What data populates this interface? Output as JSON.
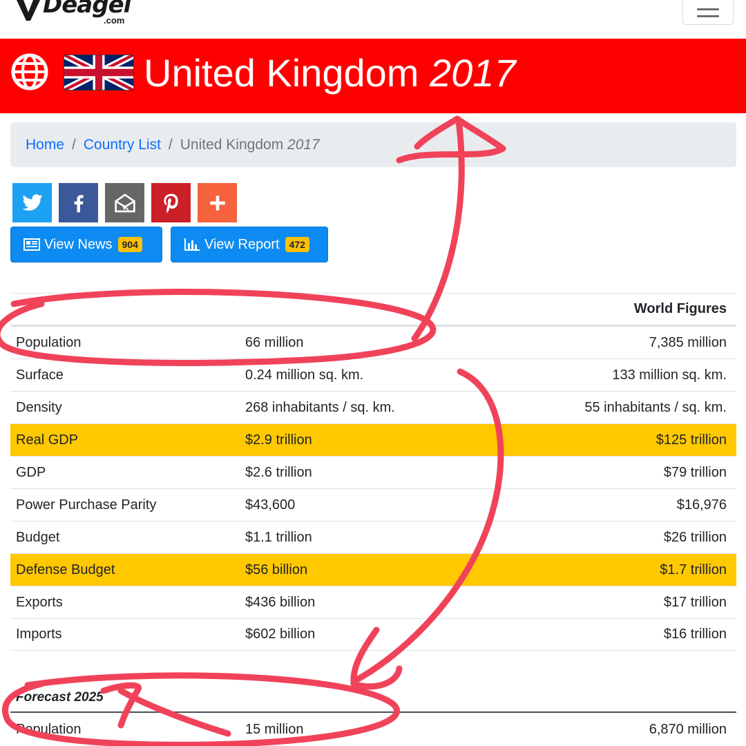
{
  "logo": {
    "brand": "Deagel",
    "sub": ".com"
  },
  "banner": {
    "title": "United Kingdom",
    "year": "2017"
  },
  "breadcrumb": {
    "home": "Home",
    "country_list": "Country List",
    "current_name": "United Kingdom",
    "current_year": "2017",
    "separator": "/"
  },
  "share": {
    "icons": [
      "twitter-icon",
      "facebook-icon",
      "email-icon",
      "pinterest-icon",
      "plus-icon"
    ],
    "colors": {
      "twitter": "#1da1f2",
      "facebook": "#3b5998",
      "email": "#666666",
      "pinterest": "#cb2027",
      "more": "#f5623c"
    }
  },
  "actions": {
    "news_label": "View News",
    "news_count": "904",
    "report_label": "View Report",
    "report_count": "472"
  },
  "table": {
    "header_world": "World Figures",
    "rows": [
      {
        "label": "Population",
        "value": "66 million",
        "world": "7,385 million",
        "highlight": false
      },
      {
        "label": "Surface",
        "value": "0.24 million sq. km.",
        "world": "133 million sq. km.",
        "highlight": false
      },
      {
        "label": "Density",
        "value": "268 inhabitants / sq. km.",
        "world": "55 inhabitants / sq. km.",
        "highlight": false
      },
      {
        "label": "Real GDP",
        "value": "$2.9 trillion",
        "world": "$125 trillion",
        "highlight": true
      },
      {
        "label": "GDP",
        "value": "$2.6 trillion",
        "world": "$79 trillion",
        "highlight": false
      },
      {
        "label": "Power Purchase Parity",
        "value": "$43,600",
        "world": "$16,976",
        "highlight": false
      },
      {
        "label": "Budget",
        "value": "$1.1 trillion",
        "world": "$26 trillion",
        "highlight": false
      },
      {
        "label": "Defense Budget",
        "value": "$56 billion",
        "world": "$1.7 trillion",
        "highlight": true
      },
      {
        "label": "Exports",
        "value": "$436 billion",
        "world": "$17 trillion",
        "highlight": false
      },
      {
        "label": "Imports",
        "value": "$602 billion",
        "world": "$16 trillion",
        "highlight": false
      }
    ]
  },
  "forecast": {
    "heading": "Forecast 2025",
    "row": {
      "label": "Population",
      "value": "15 million",
      "world": "6,870 million"
    }
  },
  "colors": {
    "banner": "#ff0000",
    "highlight": "#ffc800",
    "primary": "#0d8bf2",
    "badge": "#ffc107",
    "annotation": "#f0435a"
  }
}
